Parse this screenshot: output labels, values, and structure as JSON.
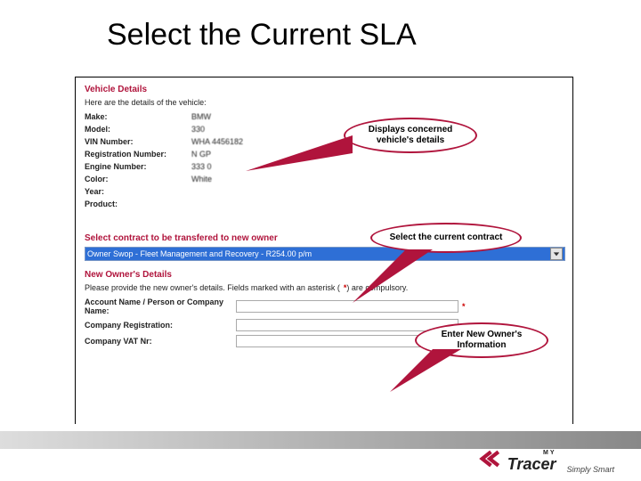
{
  "title": "Select the Current SLA",
  "vehicle": {
    "heading": "Vehicle Details",
    "subtitle": "Here are the details of the vehicle:",
    "labels": {
      "make": "Make:",
      "model": "Model:",
      "vin": "VIN Number:",
      "reg": "Registration Number:",
      "engine": "Engine Number:",
      "color": "Color:",
      "year": "Year:",
      "product": "Product:"
    },
    "values": {
      "make": "BMW",
      "model": "330",
      "vin": "WHA      4456182",
      "reg": "N      GP",
      "engine": "333   0",
      "color": "White",
      "year": "",
      "product": ""
    }
  },
  "contract": {
    "heading": "Select contract to be transfered to new owner",
    "selected": "Owner Swop - Fleet Management and Recovery - R254.00 p/m"
  },
  "newOwner": {
    "heading": "New Owner's Details",
    "note_prefix": "Please provide the new owner's details. Fields marked with an asterisk (",
    "note_star": "*",
    "note_suffix": ") are compulsory.",
    "labels": {
      "accountName": "Account Name / Person or Company Name:",
      "companyReg": "Company Registration:",
      "companyVat": "Company VAT Nr:"
    },
    "required_mark": "*"
  },
  "callouts": {
    "c1": "Displays concerned vehicle's details",
    "c2": "Select the current contract",
    "c3": "Enter New Owner's Information"
  },
  "brand": {
    "top": "MY",
    "main": "Tracer",
    "tag": "Simply Smart"
  }
}
